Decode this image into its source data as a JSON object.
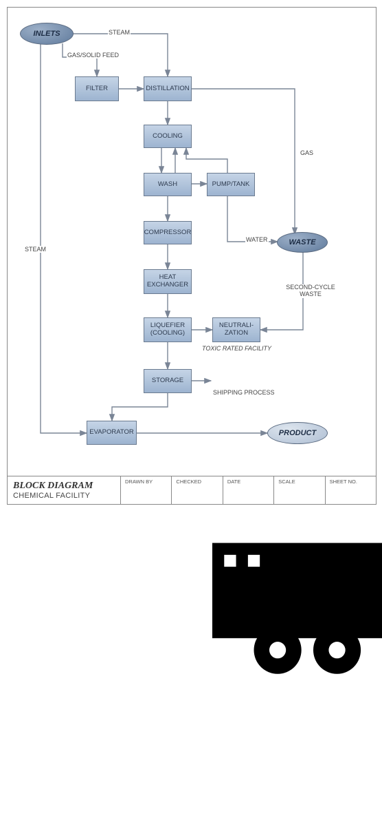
{
  "title_block": {
    "title": "BLOCK DIAGRAM",
    "subtitle": "CHEMICAL FACILITY",
    "drawn_by": "DRAWN BY",
    "checked": "CHECKED",
    "date": "DATE",
    "scale": "SCALE",
    "sheet_no": "SHEET NO."
  },
  "nodes": {
    "inlets": "INLETS",
    "filter": "FILTER",
    "distillation": "DISTILLATION",
    "cooling": "COOLING",
    "wash": "WASH",
    "pump_tank": "PUMP/TANK",
    "compressor": "COMPRESSOR",
    "heat_exchanger": "HEAT EXCHANGER",
    "liquefier": "LIQUEFIER (COOLING)",
    "neutralization": "NEUTRALI- ZATION",
    "storage": "STORAGE",
    "evaporator": "EVAPORATOR",
    "waste": "WASTE",
    "product": "PRODUCT"
  },
  "edge_labels": {
    "steam_top": "STEAM",
    "gas_solid_feed": "GAS/SOLID FEED",
    "steam_left": "STEAM",
    "gas": "GAS",
    "water": "WATER",
    "second_cycle_waste": "SECOND-CYCLE WASTE",
    "toxic": "TOXIC RATED FACILITY",
    "shipping": "SHIPPING PROCESS"
  },
  "flow_edges": [
    {
      "from": "inlets",
      "to": "filter",
      "label": "GAS/SOLID FEED"
    },
    {
      "from": "inlets",
      "to": "distillation",
      "label": "STEAM"
    },
    {
      "from": "inlets",
      "to": "evaporator",
      "label": "STEAM"
    },
    {
      "from": "filter",
      "to": "distillation"
    },
    {
      "from": "distillation",
      "to": "cooling"
    },
    {
      "from": "distillation",
      "to": "waste",
      "label": "GAS"
    },
    {
      "from": "cooling",
      "to": "wash"
    },
    {
      "from": "wash",
      "to": "pump_tank"
    },
    {
      "from": "pump_tank",
      "to": "cooling"
    },
    {
      "from": "wash",
      "to": "compressor"
    },
    {
      "from": "pump_tank",
      "to": "waste",
      "label": "WATER"
    },
    {
      "from": "compressor",
      "to": "heat_exchanger"
    },
    {
      "from": "heat_exchanger",
      "to": "liquefier"
    },
    {
      "from": "liquefier",
      "to": "neutralization"
    },
    {
      "from": "neutralization",
      "to": "waste",
      "label": "SECOND-CYCLE WASTE"
    },
    {
      "from": "liquefier",
      "to": "storage"
    },
    {
      "from": "storage",
      "to": "shipping_process"
    },
    {
      "from": "storage",
      "to": "evaporator"
    },
    {
      "from": "evaporator",
      "to": "product"
    }
  ]
}
